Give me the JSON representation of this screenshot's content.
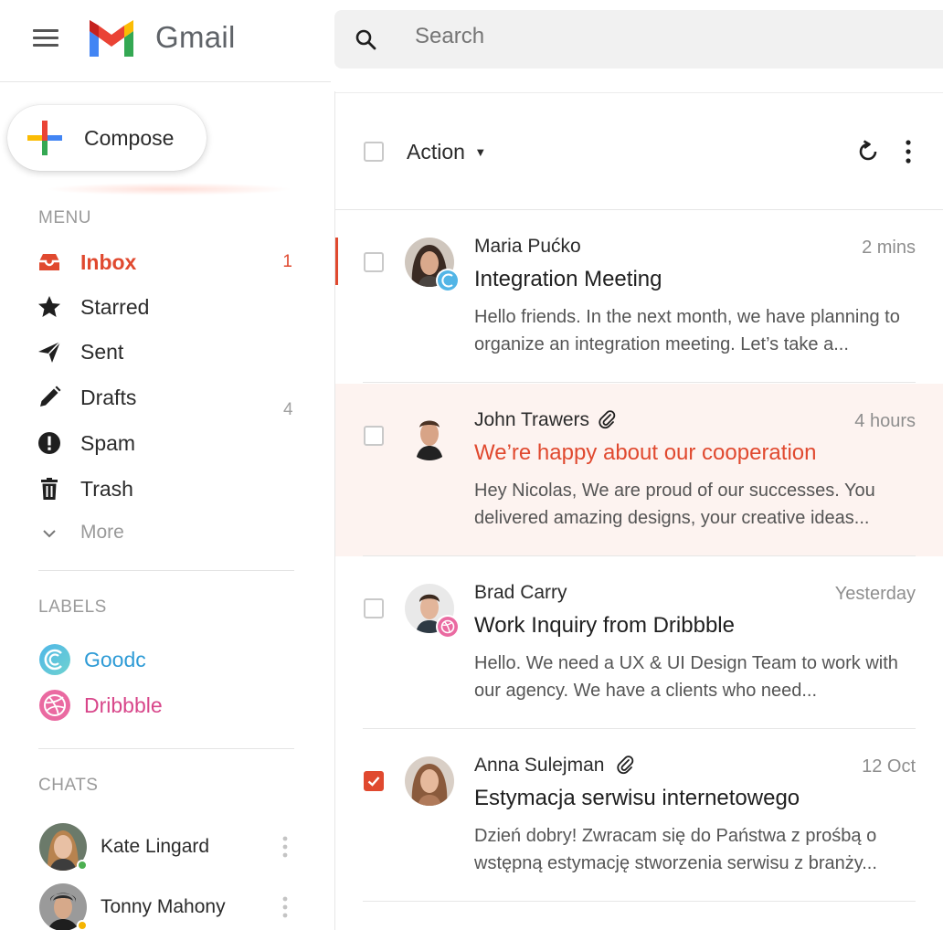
{
  "app": {
    "name": "Gmail"
  },
  "search": {
    "placeholder": "Search"
  },
  "compose": {
    "label": "Compose"
  },
  "menu": {
    "heading": "MENU",
    "items": [
      {
        "label": "Inbox",
        "icon": "inbox-icon",
        "count": "1",
        "active": true
      },
      {
        "label": "Starred",
        "icon": "star-icon"
      },
      {
        "label": "Sent",
        "icon": "send-icon"
      },
      {
        "label": "Drafts",
        "icon": "pencil-icon",
        "count": "4"
      },
      {
        "label": "Spam",
        "icon": "alert-icon"
      },
      {
        "label": "Trash",
        "icon": "trash-icon"
      },
      {
        "label": "More",
        "icon": "chevron-down-icon"
      }
    ]
  },
  "labels": {
    "heading": "LABELS",
    "items": [
      {
        "label": "Goodc",
        "color": "#2e9bd6",
        "icon": "goodc-logo-icon"
      },
      {
        "label": "Dribbble",
        "color": "#d8468a",
        "icon": "dribbble-icon"
      }
    ]
  },
  "chats": {
    "heading": "CHATS",
    "items": [
      {
        "name": "Kate Lingard",
        "status_color": "#4caf50"
      },
      {
        "name": "Tonny Mahony",
        "status_color": "#f5b400"
      }
    ]
  },
  "toolbar": {
    "action_label": "Action"
  },
  "emails": [
    {
      "sender": "Maria Pućko",
      "time": "2 mins",
      "subject": "Integration Meeting",
      "preview": "Hello friends. In the next month, we have planning to organize an integration meeting. Let’s take a...",
      "attachment": false,
      "checked": false,
      "badge": "goodc-logo-icon"
    },
    {
      "sender": "John Trawers",
      "time": "4 hours",
      "subject": "We’re happy about our cooperation",
      "preview": "Hey Nicolas, We are proud of our successes. You delivered amazing designs, your creative ideas...",
      "attachment": true,
      "checked": false,
      "highlighted": true
    },
    {
      "sender": "Brad Carry",
      "time": "Yesterday",
      "subject": "Work Inquiry from Dribbble",
      "preview": "Hello. We need a UX & UI Design Team to work with our agency. We have a clients who need...",
      "attachment": false,
      "checked": false,
      "badge": "dribbble-icon"
    },
    {
      "sender": "Anna Sulejman",
      "time": "12 Oct",
      "subject": "Estymacja serwisu internetowego",
      "preview": "Dzień dobry! Zwracam się do Państwa z prośbą o wstępną estymację stworzenia serwisu z branży...",
      "attachment": true,
      "checked": true
    }
  ],
  "colors": {
    "accent": "#e0492f",
    "highlight_row": "#fdf3f0"
  }
}
